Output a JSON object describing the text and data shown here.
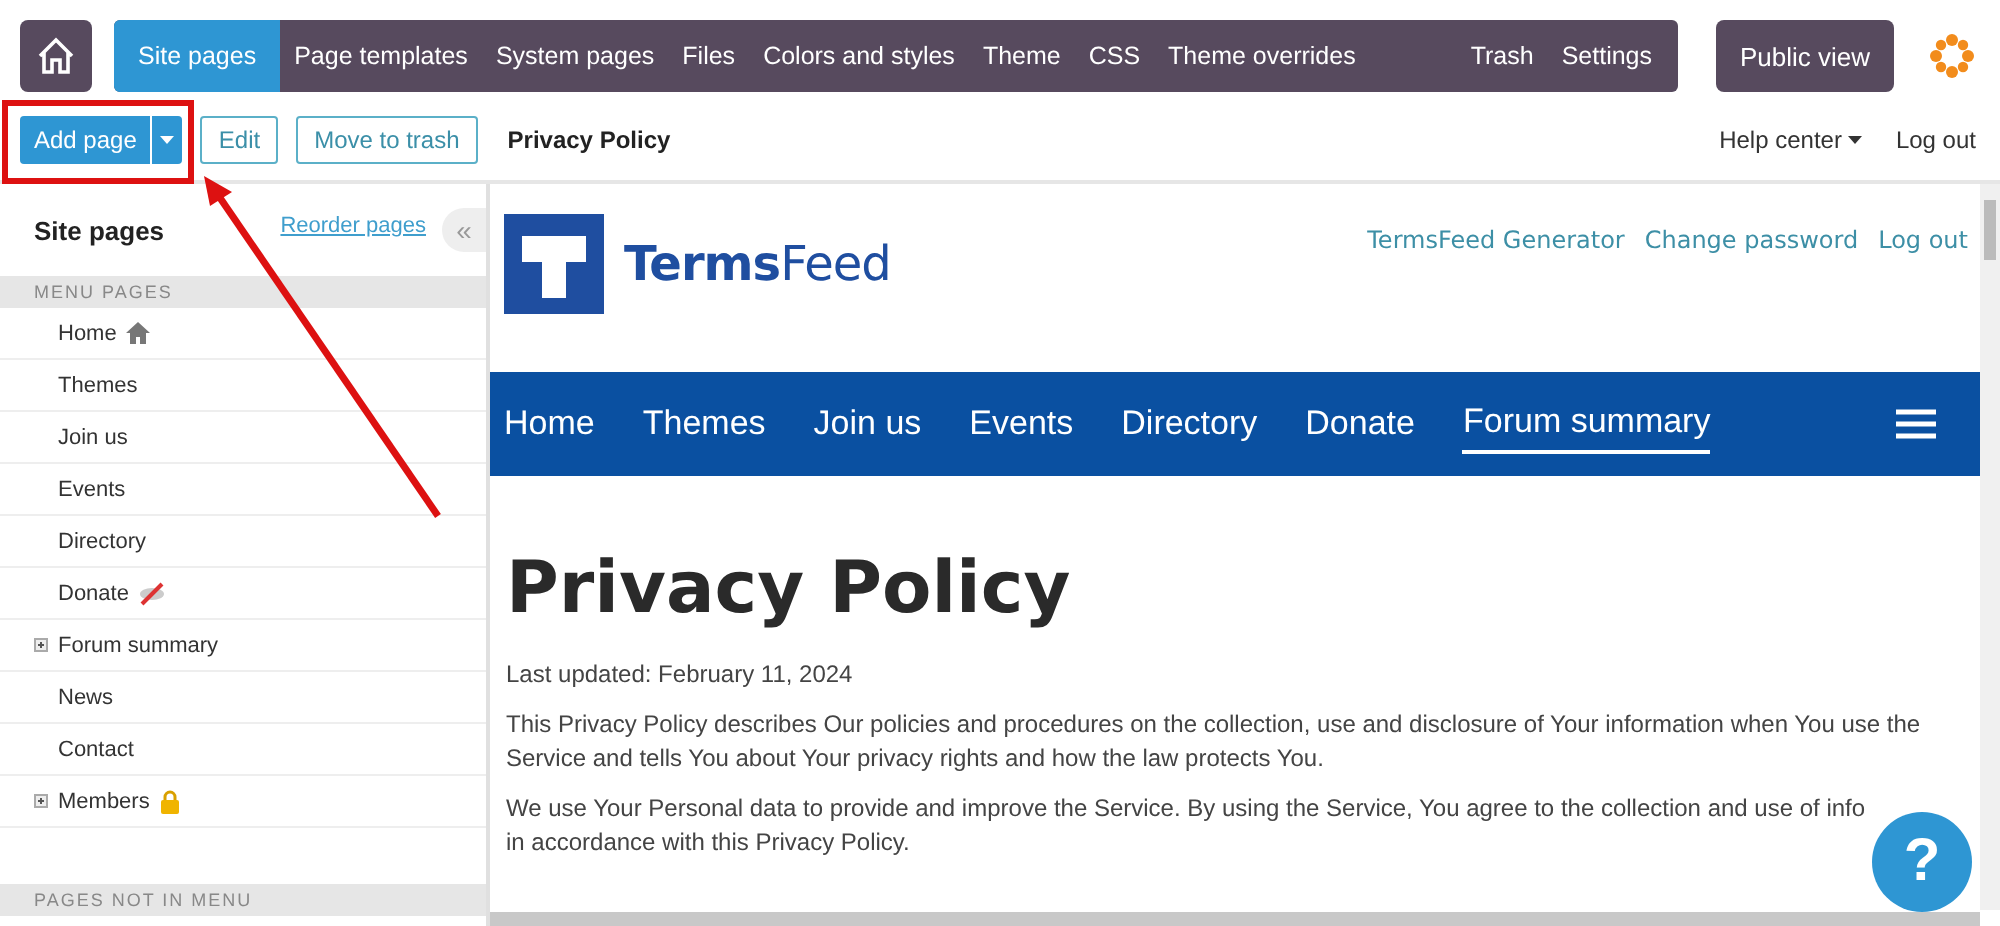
{
  "admin_nav": {
    "tabs": [
      {
        "label": "Site pages",
        "selected": true
      },
      {
        "label": "Page templates",
        "selected": false
      },
      {
        "label": "System pages",
        "selected": false
      },
      {
        "label": "Files",
        "selected": false
      },
      {
        "label": "Colors and styles",
        "selected": false
      },
      {
        "label": "Theme",
        "selected": false
      },
      {
        "label": "CSS",
        "selected": false
      },
      {
        "label": "Theme overrides",
        "selected": false
      }
    ],
    "right_tabs": [
      {
        "label": "Trash",
        "selected": false
      },
      {
        "label": "Settings",
        "selected": false
      }
    ],
    "public_view": "Public view"
  },
  "toolbar": {
    "add_page": "Add page",
    "edit": "Edit",
    "move_to_trash": "Move to trash",
    "page_title": "Privacy Policy",
    "help_center": "Help center",
    "log_out": "Log out"
  },
  "sidebar": {
    "title": "Site pages",
    "reorder": "Reorder pages",
    "collapse": "«",
    "sections": [
      {
        "heading": "MENU PAGES",
        "items": [
          {
            "label": "Home",
            "kind": "home",
            "expandable": false
          },
          {
            "label": "Themes",
            "kind": "plain",
            "expandable": false
          },
          {
            "label": "Join us",
            "kind": "plain",
            "expandable": false
          },
          {
            "label": "Events",
            "kind": "plain",
            "expandable": false
          },
          {
            "label": "Directory",
            "kind": "plain",
            "expandable": false
          },
          {
            "label": "Donate",
            "kind": "hidden",
            "expandable": false
          },
          {
            "label": "Forum summary",
            "kind": "plain",
            "expandable": true
          },
          {
            "label": "News",
            "kind": "plain",
            "expandable": false
          },
          {
            "label": "Contact",
            "kind": "plain",
            "expandable": false
          },
          {
            "label": "Members",
            "kind": "locked",
            "expandable": true
          }
        ]
      },
      {
        "heading": "PAGES NOT IN MENU"
      }
    ]
  },
  "site": {
    "logo_a": "Terms",
    "logo_b": "Feed",
    "top_links": [
      "TermsFeed Generator",
      "Change password",
      "Log out"
    ],
    "nav": [
      {
        "label": "Home",
        "selected": false
      },
      {
        "label": "Themes",
        "selected": false
      },
      {
        "label": "Join us",
        "selected": false
      },
      {
        "label": "Events",
        "selected": false
      },
      {
        "label": "Directory",
        "selected": false
      },
      {
        "label": "Donate",
        "selected": false
      },
      {
        "label": "Forum summary",
        "selected": true
      }
    ],
    "heading": "Privacy Policy",
    "paragraphs": [
      "Last updated: February 11, 2024",
      "This Privacy Policy describes Our policies and procedures on the collection, use and disclosure of Your information when You use the Service and tells You about Your privacy rights and how the law protects You.",
      "We use Your Personal data to provide and improve the Service. By using the Service, You agree to the collection and use of info"
    ],
    "paragraph_end": "in accordance with this Privacy Policy.",
    "help": "?"
  }
}
